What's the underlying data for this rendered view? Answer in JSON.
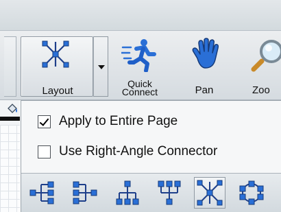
{
  "toolbar": {
    "layout_label": "Layout",
    "quick_connect_line1": "Quick",
    "quick_connect_line2": "Connect",
    "pan_label": "Pan",
    "zoom_label": "Zoo"
  },
  "dropdown": {
    "options": [
      {
        "label": "Apply to Entire Page",
        "checked": true
      },
      {
        "label": "Use Right-Angle Connector",
        "checked": false
      }
    ],
    "layout_icons": [
      "tree-left-icon",
      "tree-right-icon",
      "tree-down-icon",
      "tree-up-icon",
      "star-layout-icon",
      "circle-layout-icon"
    ],
    "selected_layout": "star-layout-icon"
  },
  "colors": {
    "icon_blue": "#2a6fd6",
    "icon_dark": "#1e3f8a",
    "toolbar_bg": "#e1e6ea"
  }
}
